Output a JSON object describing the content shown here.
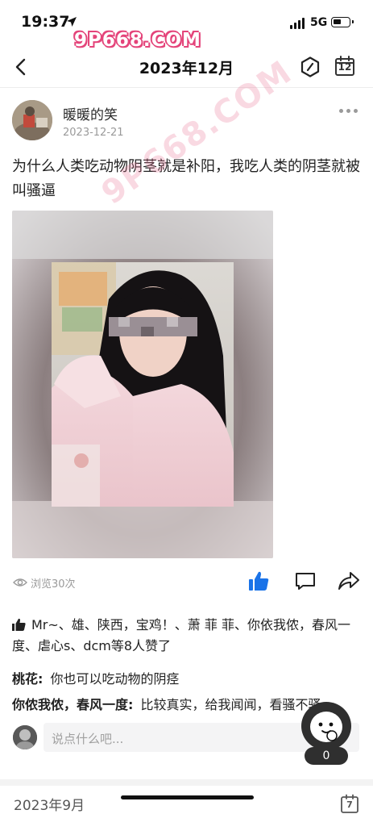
{
  "status": {
    "time": "19:37",
    "network": "5G"
  },
  "watermark": {
    "top": "9P668.COM",
    "diagonal": "9P668.COM"
  },
  "nav": {
    "title": "2023年12月",
    "calendar_day": "12"
  },
  "post": {
    "author": "暖暖的笑",
    "date": "2023-12-21",
    "text": "为什么人类吃动物阴茎就是补阳，我吃人类的阴茎就被叫骚逼",
    "views": "浏览30次",
    "likes_text": "Mr~、雄、陕西，宝鸡！、萧 菲 菲、你依我侬，春风一度、虐心s、dcm等8人赞了"
  },
  "comments": [
    {
      "name": "桃花:",
      "text": "你也可以吃动物的阴痉"
    },
    {
      "name": "你侬我侬，春风一度:",
      "text": "比较真实，给我闻闻，看骚不骚"
    }
  ],
  "reply": {
    "placeholder": "说点什么吧..."
  },
  "float_badge": "0",
  "next_section": {
    "month": "2023年9月",
    "calendar_day": "7"
  },
  "colors": {
    "accent": "#1a73e8",
    "watermark_pink": "#e4447a"
  },
  "icons": [
    "location-arrow-icon",
    "signal-icon",
    "battery-icon",
    "back-icon",
    "hexagon-icon",
    "calendar-icon",
    "more-icon",
    "eye-icon",
    "thumbs-up-icon",
    "comment-icon",
    "share-icon",
    "mascot-icon"
  ]
}
